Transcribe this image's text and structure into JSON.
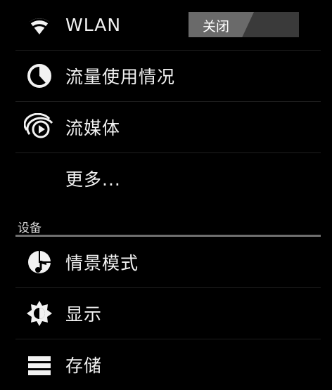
{
  "wireless": {
    "wlan": {
      "label": "WLAN",
      "toggle_text": "关闭",
      "icon": "wifi-icon"
    },
    "data_usage": {
      "label": "流量使用情况",
      "icon": "data-usage-icon"
    },
    "streaming": {
      "label": "流媒体",
      "icon": "streaming-icon"
    },
    "more": {
      "label": "更多..."
    }
  },
  "device_section": {
    "title": "设备",
    "items": [
      {
        "label": "情景模式",
        "icon": "audio-profiles-icon"
      },
      {
        "label": "显示",
        "icon": "display-brightness-icon"
      },
      {
        "label": "存储",
        "icon": "storage-icon"
      }
    ]
  },
  "colors": {
    "background": "#000000",
    "divider": "#1e1e1e",
    "section_line": "#6f6f6f"
  }
}
